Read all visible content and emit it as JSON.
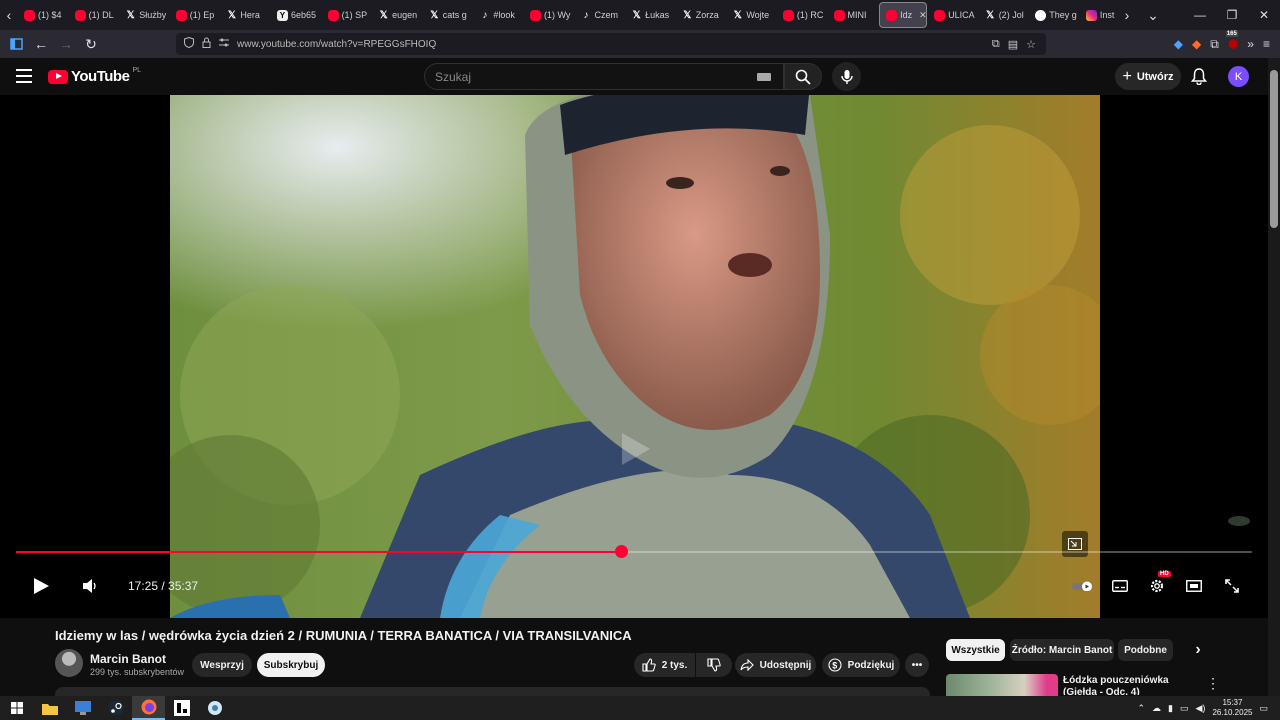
{
  "browser": {
    "tabs": [
      {
        "label": "(1) $4",
        "icon": "youtube"
      },
      {
        "label": "(1) DL",
        "icon": "youtube"
      },
      {
        "label": "Służby",
        "icon": "x"
      },
      {
        "label": "(1) Ep",
        "icon": "youtube"
      },
      {
        "label": "Hera",
        "icon": "x"
      },
      {
        "label": "6eb65",
        "icon": "y"
      },
      {
        "label": "(1) SP",
        "icon": "youtube"
      },
      {
        "label": "eugen",
        "icon": "x"
      },
      {
        "label": "cats g",
        "icon": "x"
      },
      {
        "label": "#look",
        "icon": "tiktok"
      },
      {
        "label": "(1) Wy",
        "icon": "youtube"
      },
      {
        "label": "Czem",
        "icon": "tiktok"
      },
      {
        "label": "Łukas",
        "icon": "x"
      },
      {
        "label": "Zorza",
        "icon": "x"
      },
      {
        "label": "Wojte",
        "icon": "x"
      },
      {
        "label": "(1) RC",
        "icon": "youtube"
      },
      {
        "label": "MINI",
        "icon": "youtube"
      },
      {
        "label": "Idz",
        "icon": "youtube",
        "active": true
      },
      {
        "label": "ULICA",
        "icon": "youtube"
      },
      {
        "label": "(2) Jol",
        "icon": "x"
      },
      {
        "label": "They g",
        "icon": "github"
      },
      {
        "label": "Inst",
        "icon": "instagram"
      }
    ],
    "url": "www.youtube.com/watch?v=RPEGGsFHOIQ",
    "extension_badge": "165"
  },
  "youtube": {
    "logo_text": "YouTube",
    "country_code": "PL",
    "search_placeholder": "Szukaj",
    "create_label": "Utwórz",
    "avatar_letter": "K"
  },
  "player": {
    "current_time": "17:25",
    "duration": "35:37",
    "progress": 0.49,
    "hd_badge": "HD"
  },
  "video": {
    "title": "Idziemy w las / wędrówka życia dzień 2 / RUMUNIA / TERRA BANATICA / VIA TRANSILVANICA",
    "channel": "Marcin Banot",
    "subscribers": "299 tys. subskrybentów",
    "support_label": "Wesprzyj",
    "subscribe_label": "Subskrybuj",
    "likes": "2 tys.",
    "share_label": "Udostępnij",
    "thanks_label": "Podziękuj"
  },
  "sidebar": {
    "chips": [
      "Wszystkie",
      "Źródło: Marcin Banot",
      "Podobne"
    ],
    "suggestion_title": "Łódzka pouczeniówka (Giełda - Odc. 4)"
  },
  "taskbar": {
    "time": "15:37",
    "date": "26.10.2025"
  }
}
